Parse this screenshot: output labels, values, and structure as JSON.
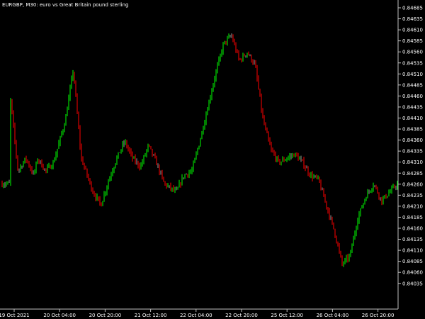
{
  "title": {
    "symbol": "EURGBP,",
    "timeframe": "M30",
    "description": "euro vs Great Britain pound sterling"
  },
  "colors": {
    "background": "#000000",
    "axis": "#c0c0c0",
    "text": "#ffffff",
    "bull": "#00ff00",
    "bear": "#ff0000",
    "doji": "#9a9a9a"
  },
  "chart_data": {
    "type": "candlestick-bars",
    "yaxis_ticks": [
      "0.84685",
      "0.84635",
      "0.84610",
      "0.84585",
      "0.84560",
      "0.84535",
      "0.84510",
      "0.84485",
      "0.84460",
      "0.84435",
      "0.84410",
      "0.84385",
      "0.84360",
      "0.84335",
      "0.84310",
      "0.84285",
      "0.84260",
      "0.84235",
      "0.84210",
      "0.84185",
      "0.84160",
      "0.84135",
      "0.84110",
      "0.84085",
      "0.84060",
      "0.84035"
    ],
    "xaxis_ticks": [
      "19 Oct 2021",
      "20 Oct 04:00",
      "20 Oct 20:00",
      "21 Oct 12:00",
      "22 Oct 04:00",
      "22 Oct 20:00",
      "25 Oct 12:00",
      "26 Oct 04:00",
      "26 Oct 20:00"
    ],
    "ylim": [
      0.84035,
      0.84685
    ],
    "close_path": [
      [
        0.02,
        0.8448
      ],
      [
        0.04,
        0.843
      ],
      [
        0.06,
        0.8433
      ],
      [
        0.08,
        0.8429
      ],
      [
        0.09,
        0.8433
      ],
      [
        0.11,
        0.843
      ],
      [
        0.13,
        0.8432
      ],
      [
        0.16,
        0.8442
      ],
      [
        0.18,
        0.8454
      ],
      [
        0.2,
        0.8433
      ],
      [
        0.23,
        0.8425
      ],
      [
        0.25,
        0.8422
      ],
      [
        0.27,
        0.8428
      ],
      [
        0.29,
        0.8433
      ],
      [
        0.31,
        0.8437
      ],
      [
        0.33,
        0.8433
      ],
      [
        0.35,
        0.8431
      ],
      [
        0.37,
        0.8436
      ],
      [
        0.39,
        0.8432
      ],
      [
        0.41,
        0.8427
      ],
      [
        0.44,
        0.8425
      ],
      [
        0.46,
        0.8429
      ],
      [
        0.48,
        0.843
      ],
      [
        0.5,
        0.8437
      ],
      [
        0.52,
        0.8445
      ],
      [
        0.54,
        0.8453
      ],
      [
        0.56,
        0.846
      ],
      [
        0.58,
        0.8462
      ],
      [
        0.6,
        0.8456
      ],
      [
        0.62,
        0.8458
      ],
      [
        0.64,
        0.8455
      ],
      [
        0.66,
        0.8442
      ],
      [
        0.68,
        0.8435
      ],
      [
        0.7,
        0.8432
      ],
      [
        0.72,
        0.8433
      ],
      [
        0.74,
        0.8434
      ],
      [
        0.76,
        0.8432
      ],
      [
        0.78,
        0.8429
      ],
      [
        0.8,
        0.8428
      ],
      [
        0.82,
        0.8422
      ],
      [
        0.84,
        0.8416
      ],
      [
        0.86,
        0.8408
      ],
      [
        0.88,
        0.841
      ],
      [
        0.9,
        0.8419
      ],
      [
        0.92,
        0.8424
      ],
      [
        0.94,
        0.8427
      ],
      [
        0.96,
        0.8423
      ],
      [
        0.98,
        0.8425
      ],
      [
        1.0,
        0.8427
      ]
    ]
  }
}
